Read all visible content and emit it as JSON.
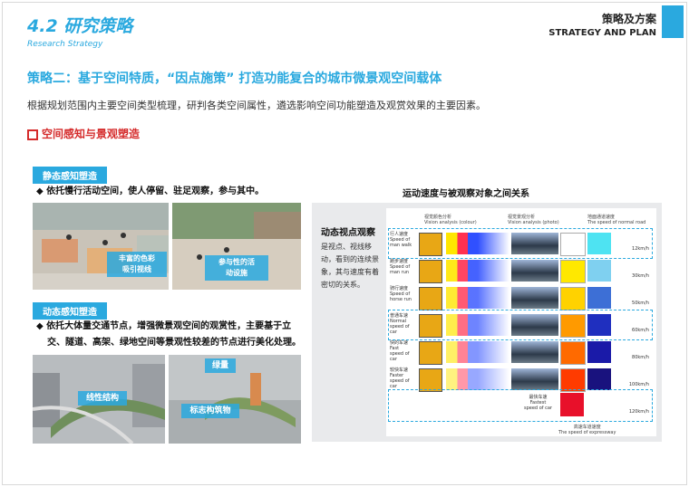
{
  "header": {
    "section_number": "4.2 研究策略",
    "section_en": "Research Strategy",
    "title_cn": "策略及方案",
    "title_en": "STRATEGY AND PLAN",
    "accent": "#2aa9df"
  },
  "strategy_title": "策略二：基于空间特质，“因点施策” 打造功能复合的城市微景观空间载体",
  "description": "根据规划范围内主要空间类型梳理，研判各类空间属性，遴选影响空间功能塑造及观赏效果的主要因素。",
  "subsection_title": "空间感知与景观塑造",
  "static": {
    "tag": "静态感知塑造",
    "bullet": "依托慢行活动空间，使人停留、驻足观察，参与其中。",
    "photo1_caption_l1": "丰富的色彩",
    "photo1_caption_l2": "吸引视线",
    "photo2_caption_l1": "参与性的活",
    "photo2_caption_l2": "动设施"
  },
  "dynamic": {
    "tag": "动态感知塑造",
    "bullet_l1": "依托大体量交通节点，增强微景观空间的观赏性，主要基于立",
    "bullet_l2": "交、隧道、高架、绿地空间等景观性较差的节点进行美化处理。",
    "photo3_caption": "线性结构",
    "photo4_caption_top": "绿量",
    "photo4_caption": "标志构筑物"
  },
  "right": {
    "title": "运动速度与被观察对象之间关系",
    "dyn_title": "动态视点观察",
    "dyn_text": "是视点、视线移动，看到的连续景象，其与速度有着密切的关系。",
    "col_headers": [
      "视觉颜色分析",
      "视觉景观分析",
      "地面通道速度"
    ],
    "col_headers_en": [
      "Vision analysis (colour)",
      "Vision analysis (photo)",
      "The speed of normal road"
    ],
    "rows": [
      {
        "cn": "行人速度",
        "en1": "Speed of",
        "en2": "man walk",
        "icon": "walk-icon",
        "speed": "12km/h"
      },
      {
        "cn": "跑步速度",
        "en1": "Speed of",
        "en2": "man run",
        "icon": "run-icon",
        "speed": "30km/h"
      },
      {
        "cn": "骑行速度",
        "en1": "Speed of",
        "en2": "horse run",
        "icon": "horse-icon",
        "speed": "50km/h"
      },
      {
        "cn": "普通车速",
        "en1": "Normal",
        "en2": "speed of car",
        "icon": "truck-icon",
        "speed": "60km/h"
      },
      {
        "cn": "快的车速",
        "en1": "Fast",
        "en2": "speed of car",
        "icon": "car-icon",
        "speed": "80km/h"
      },
      {
        "cn": "较快车速",
        "en1": "Faster",
        "en2": "speed of car",
        "icon": "fast-car-icon",
        "speed": "100km/h"
      }
    ],
    "last_row": {
      "cn": "最快车速",
      "en1": "Fastest",
      "en2": "speed of car",
      "speed": "120km/h"
    },
    "footer_cn": "高速车道速度",
    "footer_en": "The speed of expressway"
  }
}
